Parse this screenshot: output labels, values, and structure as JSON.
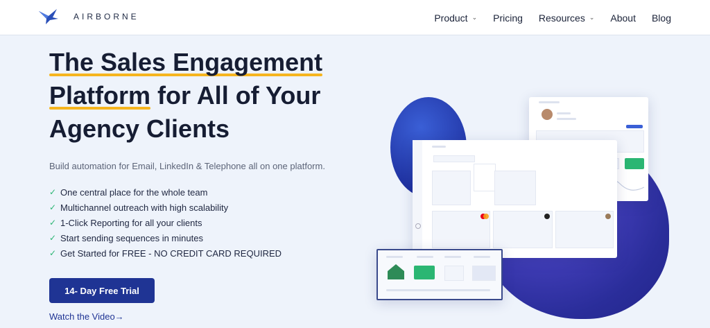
{
  "nav": {
    "logo_text": "AIRBORNE",
    "links": [
      {
        "label": "Product",
        "has_dropdown": true
      },
      {
        "label": "Pricing",
        "has_dropdown": false
      },
      {
        "label": "Resources",
        "has_dropdown": true
      },
      {
        "label": "About",
        "has_dropdown": false
      },
      {
        "label": "Blog",
        "has_dropdown": false
      }
    ]
  },
  "hero": {
    "title_line1": "The Sales Engagement",
    "title_line2_highlight": "Platform",
    "title_line2_rest": " for All of Your",
    "title_line3": "Agency Clients",
    "subtitle": "Build automation for Email, LinkedIn & Telephone all on one platform.",
    "features": [
      "One central place for the whole team",
      "Multichannel outreach with high scalability",
      "1-Click Reporting for all your clients",
      "Start sending sequences in minutes",
      "Get Started for FREE - NO CREDIT CARD REQUIRED"
    ],
    "cta_label": "14- Day Free Trial",
    "video_link": "Watch the Video"
  },
  "colors": {
    "accent": "#1f3494",
    "highlight": "#f6b51e",
    "check": "#2bb673",
    "background": "#eef3fb"
  },
  "icons": {
    "logo": "bird-logo-icon",
    "check": "check-icon",
    "dropdown": "chevron-down-icon",
    "arrow": "arrow-right-icon"
  }
}
